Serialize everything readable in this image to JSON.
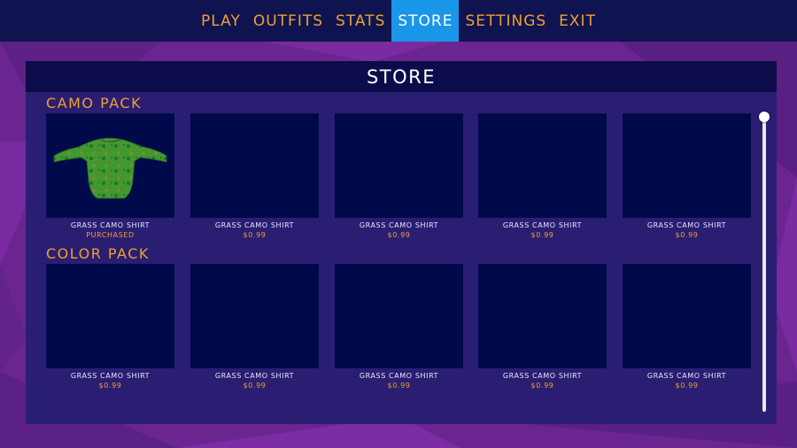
{
  "nav": {
    "items": [
      {
        "label": "PLAY"
      },
      {
        "label": "OUTFITS"
      },
      {
        "label": "STATS"
      },
      {
        "label": "STORE",
        "active": true
      },
      {
        "label": "SETTINGS"
      },
      {
        "label": "EXIT"
      }
    ]
  },
  "store": {
    "title": "STORE",
    "sections": [
      {
        "title": "CAMO PACK",
        "items": [
          {
            "name": "GRASS CAMO SHIRT",
            "price": "PURCHASED",
            "image": "green-camo-shirt"
          },
          {
            "name": "GRASS CAMO SHIRT",
            "price": "$0.99"
          },
          {
            "name": "GRASS CAMO SHIRT",
            "price": "$0.99"
          },
          {
            "name": "GRASS CAMO SHIRT",
            "price": "$0.99"
          },
          {
            "name": "GRASS CAMO SHIRT",
            "price": "$0.99"
          }
        ]
      },
      {
        "title": "COLOR PACK",
        "items": [
          {
            "name": "GRASS CAMO SHIRT",
            "price": "$0.99"
          },
          {
            "name": "GRASS CAMO SHIRT",
            "price": "$0.99"
          },
          {
            "name": "GRASS CAMO SHIRT",
            "price": "$0.99"
          },
          {
            "name": "GRASS CAMO SHIRT",
            "price": "$0.99"
          },
          {
            "name": "GRASS CAMO SHIRT",
            "price": "$0.99"
          }
        ]
      }
    ],
    "scroll_position": 0
  },
  "colors": {
    "accent": "#f0a030",
    "active_tab": "#1a96e8",
    "nav_bg": "#0f1450",
    "card_bg": "#000a4a",
    "background": "#6a2590"
  }
}
